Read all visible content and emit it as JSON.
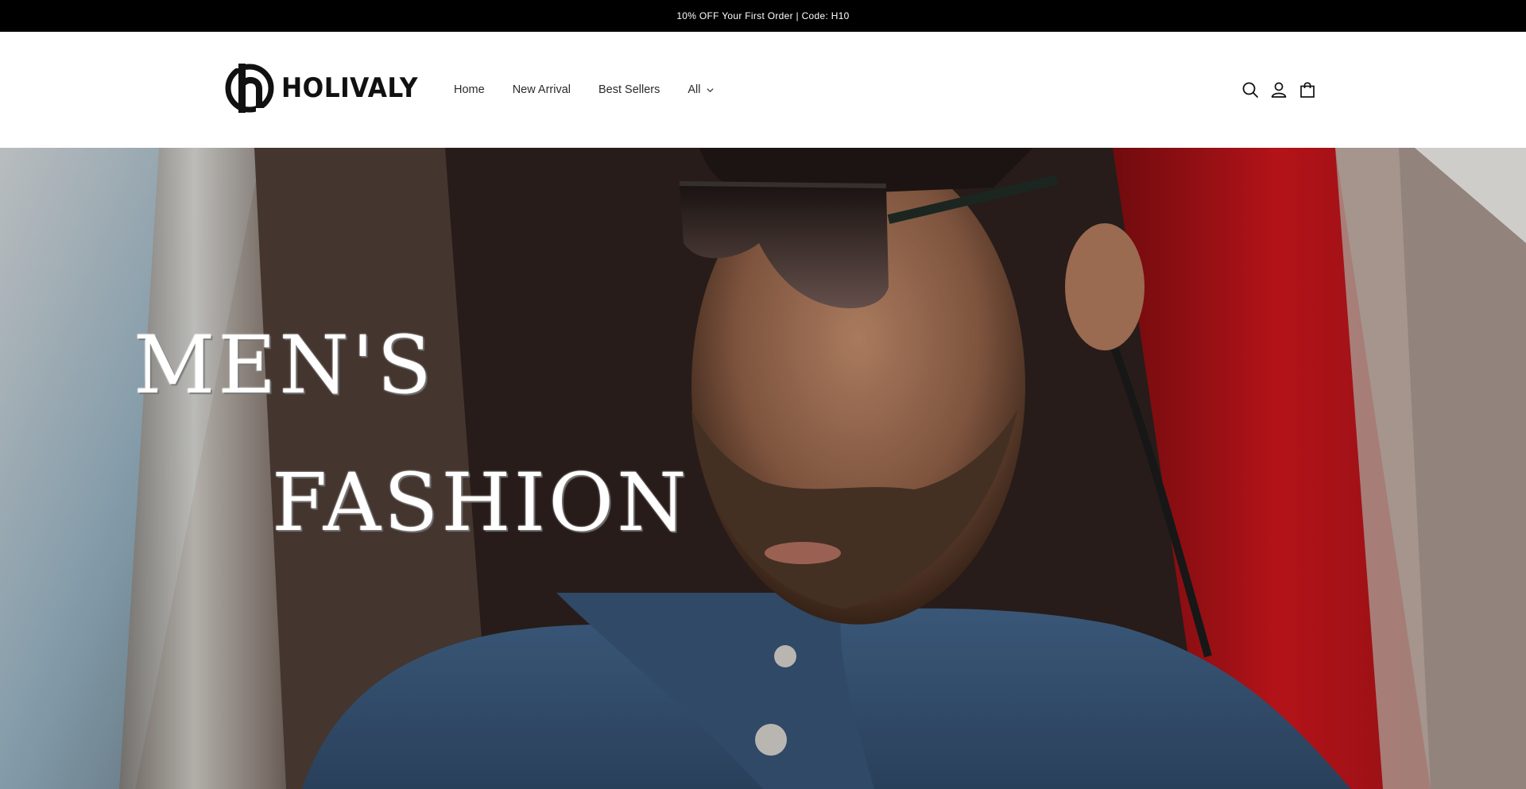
{
  "announcement": {
    "text": "10% OFF Your First Order | Code: H10"
  },
  "brand": {
    "name": "HOLIVALY"
  },
  "nav": {
    "items": [
      {
        "label": "Home"
      },
      {
        "label": "New Arrival"
      },
      {
        "label": "Best Sellers"
      },
      {
        "label": "All",
        "has_dropdown": true
      }
    ]
  },
  "header_icons": [
    "search-icon",
    "account-icon",
    "cart-icon"
  ],
  "hero": {
    "line1": "MEN'S",
    "line2": "FASHION"
  },
  "colors": {
    "announcement_bg": "#000000",
    "announcement_text": "#ffffff",
    "header_bg": "#ffffff",
    "accent_red": "#c0141a",
    "denim": "#3b5a7c"
  }
}
